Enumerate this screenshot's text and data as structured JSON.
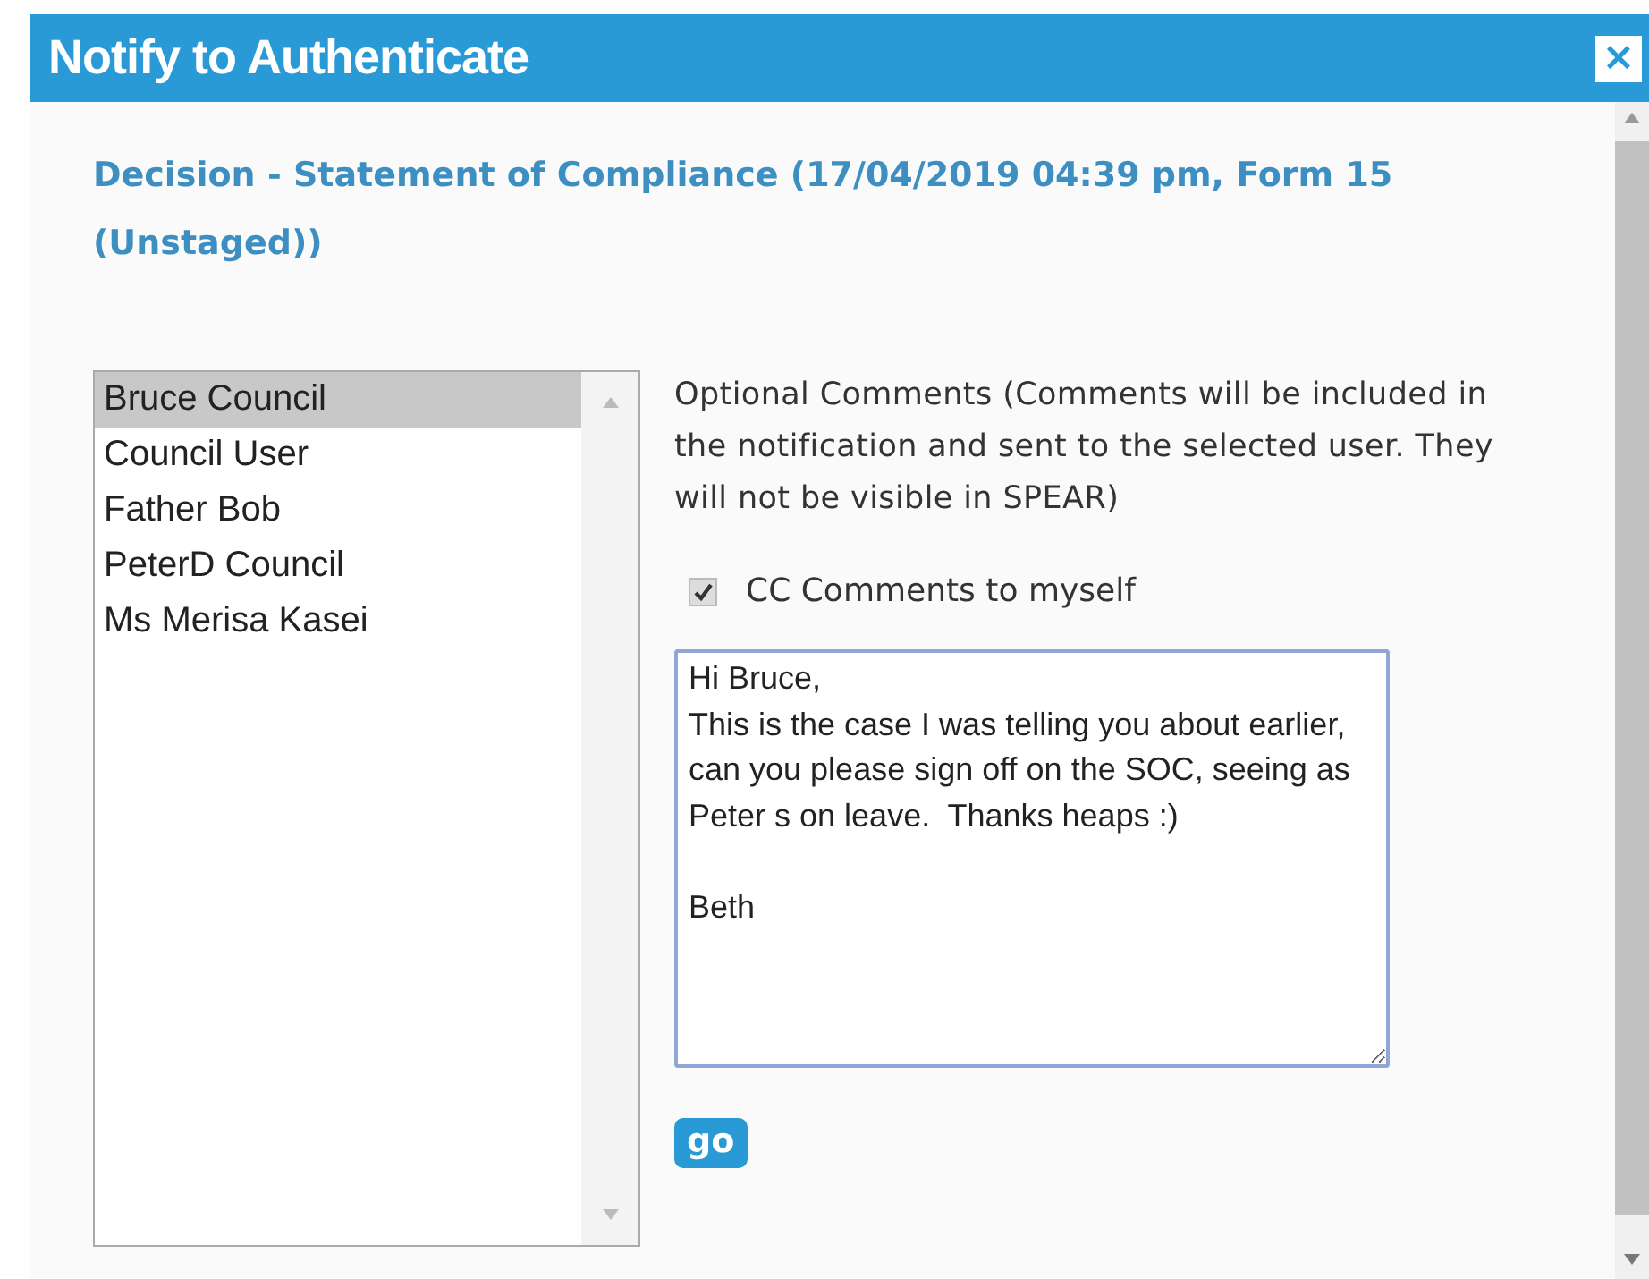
{
  "dialog": {
    "title": "Notify to Authenticate",
    "close": "×"
  },
  "heading": "Decision - Statement of Compliance (17/04/2019 04:39 pm, Form 15 (Unstaged))",
  "users": [
    {
      "name": "Bruce Council",
      "selected": true
    },
    {
      "name": "Council User",
      "selected": false
    },
    {
      "name": "Father Bob",
      "selected": false
    },
    {
      "name": "PeterD Council",
      "selected": false
    },
    {
      "name": "Ms Merisa Kasei",
      "selected": false
    }
  ],
  "comments_label": "Optional Comments (Comments will be included in the notification and sent to the selected user. They will not be visible in SPEAR)",
  "cc": {
    "label": "CC Comments to myself",
    "checked": true
  },
  "comment": {
    "value": "Hi Bruce,\nThis is the case I was telling you about earlier, can you please sign off on the SOC, seeing as Peter s on leave.  Thanks heaps :)\n\nBeth"
  },
  "go_button": "go"
}
